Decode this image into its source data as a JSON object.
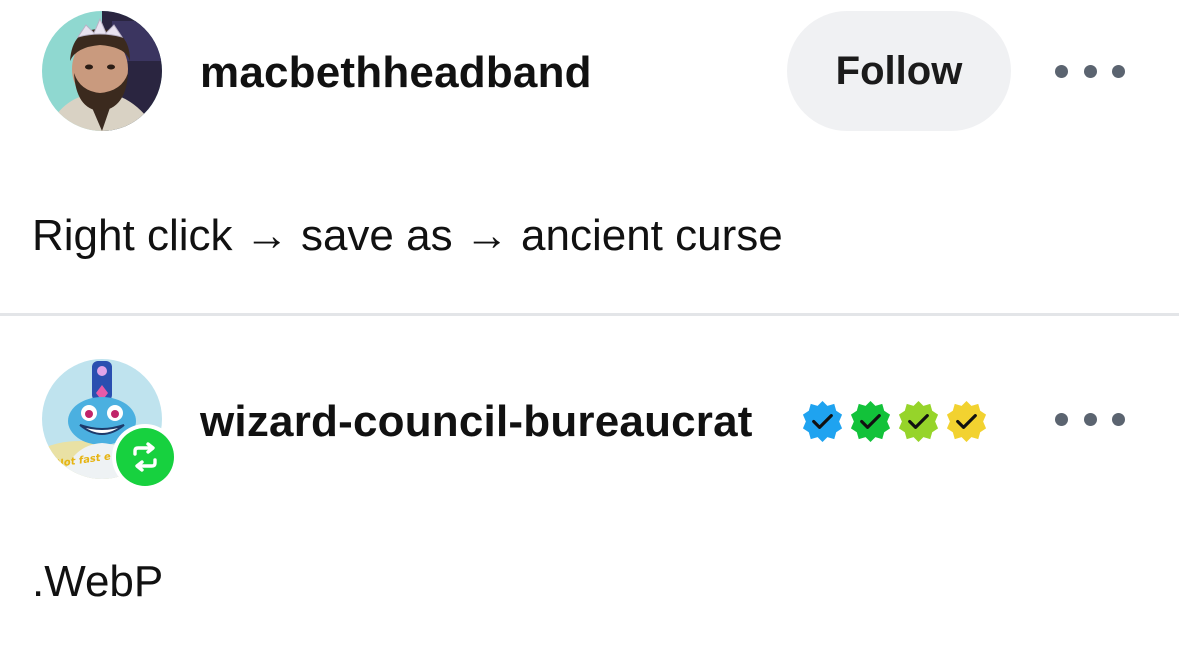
{
  "posts": [
    {
      "username": "macbethheadband",
      "follow_label": "Follow",
      "text": "Right click → save as → ancient curse",
      "avatar": "avatar-man-with-tiara"
    },
    {
      "username": "wizard-council-bureaucrat",
      "text": ".WebP",
      "avatar": "avatar-cartoon-wizard",
      "reblog_icon": "reblog-icon",
      "badges": [
        {
          "name": "verified-badge-blue",
          "color": "#1fa3f0"
        },
        {
          "name": "verified-badge-green",
          "color": "#12c23a"
        },
        {
          "name": "verified-badge-lime",
          "color": "#96d42a"
        },
        {
          "name": "verified-badge-yellow",
          "color": "#f2d230"
        }
      ]
    }
  ],
  "colors": {
    "follow_button_bg": "#f0f1f3",
    "divider": "#e3e5e8",
    "more_dots": "#5b6470",
    "reblog_green": "#17d13f"
  }
}
